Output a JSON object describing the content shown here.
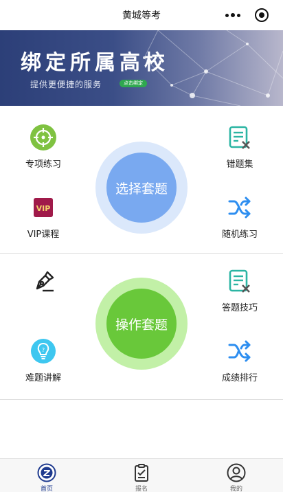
{
  "header": {
    "title": "黄城等考"
  },
  "banner": {
    "headline": "绑定所属高校",
    "subline": "提供更便捷的服务",
    "pill": "点击绑定"
  },
  "section1": {
    "left_top": {
      "label": "专项练习",
      "icon": "target-icon"
    },
    "left_bottom": {
      "label": "VIP课程",
      "icon": "vip-icon",
      "icon_text": "VIP"
    },
    "center": {
      "label": "选择套题"
    },
    "right_top": {
      "label": "错题集",
      "icon": "wrong-questions-icon"
    },
    "right_bottom": {
      "label": "随机练习",
      "icon": "shuffle-icon"
    }
  },
  "section2": {
    "left_top": {
      "label": "",
      "icon": "pen-nib-icon"
    },
    "left_bottom": {
      "label": "难题讲解",
      "icon": "lightbulb-icon"
    },
    "center": {
      "label": "操作套题"
    },
    "right_top": {
      "label": "答题技巧",
      "icon": "answer-tips-icon"
    },
    "right_bottom": {
      "label": "成绩排行",
      "icon": "shuffle-icon"
    }
  },
  "tabbar": {
    "items": [
      {
        "label": "首页",
        "icon": "home-logo-icon",
        "active": true
      },
      {
        "label": "报名",
        "icon": "clipboard-icon",
        "active": false
      },
      {
        "label": "我的",
        "icon": "user-icon",
        "active": false
      }
    ]
  },
  "colors": {
    "accent_blue": "#79a9f0",
    "accent_green": "#69c83a",
    "icon_teal": "#2bb5a3",
    "icon_blue": "#2d8ef0",
    "tab_active": "#1f3b8f"
  }
}
